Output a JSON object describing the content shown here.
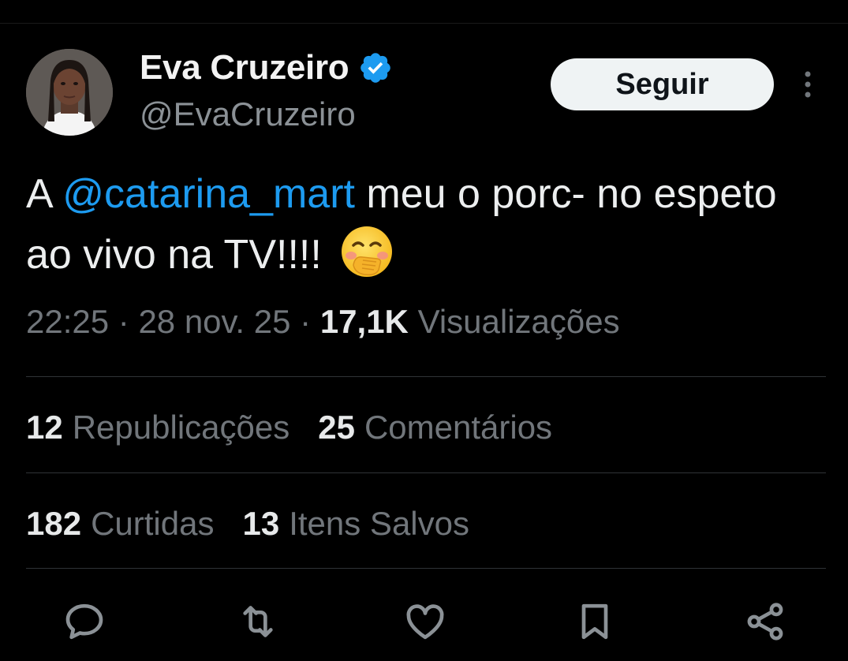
{
  "author": {
    "name": "Eva Cruzeiro",
    "handle": "@EvaCruzeiro",
    "verified": true
  },
  "follow_label": "Seguir",
  "tweet": {
    "text_before": "A ",
    "mention": "@catarina_mart",
    "text_after": " meu o porc- no espeto ao vivo na TV!!!! ",
    "emoji": "face-with-hand-over-mouth"
  },
  "meta": {
    "time": "22:25",
    "date": "28 nov. 25",
    "views_count": "17,1K",
    "views_label": "Visualizações"
  },
  "stats_row1": [
    {
      "count": "12",
      "label": "Republicações"
    },
    {
      "count": "25",
      "label": "Comentários"
    }
  ],
  "stats_row2": [
    {
      "count": "182",
      "label": "Curtidas"
    },
    {
      "count": "13",
      "label": "Itens Salvos"
    }
  ],
  "actions": [
    "reply-icon",
    "repost-icon",
    "like-icon",
    "bookmark-icon",
    "share-icon"
  ],
  "colors": {
    "background": "#000000",
    "mention": "#1d9bf0",
    "secondary_text": "#71767b",
    "verified": "#1d9bf0"
  }
}
